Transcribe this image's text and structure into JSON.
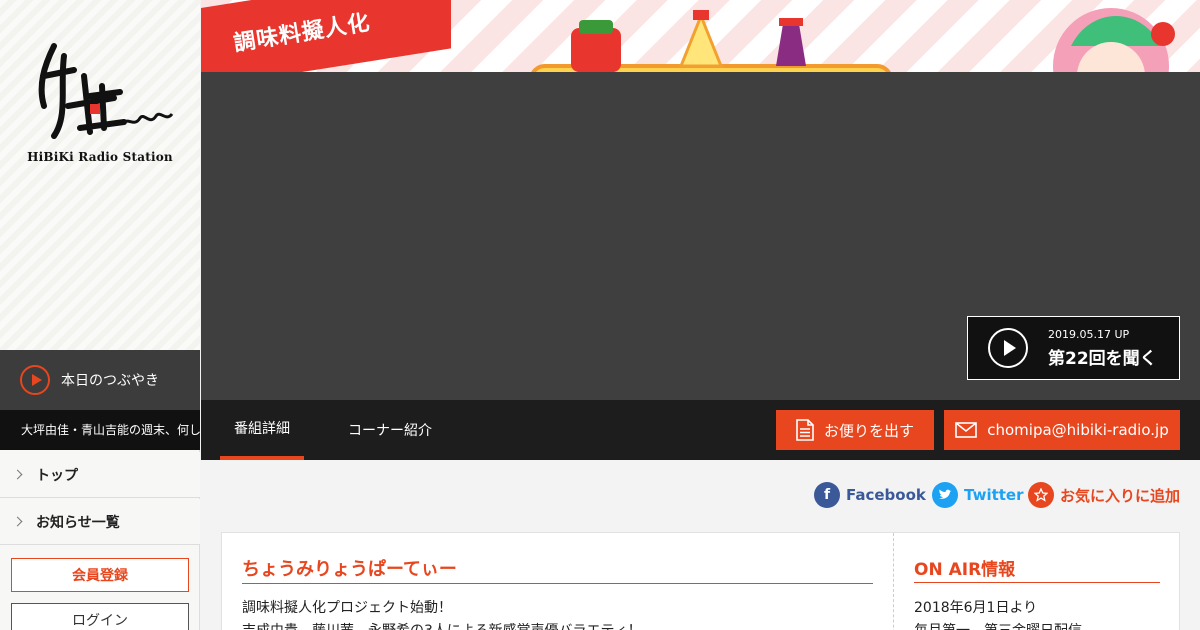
{
  "sidebar": {
    "logo_text": "HiBiKi Radio Station",
    "tweet_title": "本日のつぶやき",
    "tweet_body": "大坪由佳・青山吉能の週末、何し",
    "nav": [
      {
        "label": "トップ"
      },
      {
        "label": "お知らせ一覧"
      }
    ],
    "register_label": "会員登録",
    "login_label": "ログイン"
  },
  "banner": {
    "ribbon_text": "調味料擬人化"
  },
  "player": {
    "date": "2019.05.17 UP",
    "listen_label": "第22回を聞く"
  },
  "tabs": {
    "items": [
      {
        "label": "番組詳細"
      },
      {
        "label": "コーナー紹介"
      }
    ],
    "letter_label": "お便りを出す",
    "email_label": "chomipa@hibiki-radio.jp"
  },
  "social": {
    "facebook": "Facebook",
    "twitter": "Twitter",
    "favorite": "お気に入りに追加"
  },
  "program": {
    "title": "ちょうみりょうぱーてぃー",
    "lines": [
      "調味料擬人化プロジェクト始動！",
      "吉成由貴、藤川茜、永野希の3人による新感覚声優バラエティ！"
    ]
  },
  "onair": {
    "title": "ON AIR情報",
    "lines": [
      "2018年6月1日より",
      "毎月第一、第三金曜日配信"
    ]
  },
  "colors": {
    "accent": "#e8461e",
    "dark": "#1d1d1d",
    "player_bg": "#3f3f3f",
    "facebook": "#3b5998",
    "twitter": "#1da1f2"
  }
}
